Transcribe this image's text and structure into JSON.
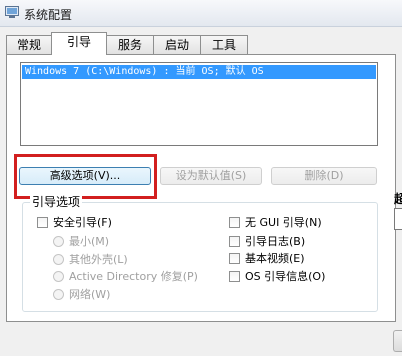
{
  "window": {
    "title": "系统配置"
  },
  "tabs": [
    {
      "label": "常规"
    },
    {
      "label": "引导"
    },
    {
      "label": "服务"
    },
    {
      "label": "启动"
    },
    {
      "label": "工具"
    }
  ],
  "boot_list": {
    "items": [
      {
        "text": "Windows 7 (C:\\Windows) : 当前 OS; 默认 OS"
      }
    ]
  },
  "buttons": {
    "advanced": "高级选项(V)...",
    "set_default": "设为默认值(S)",
    "delete": "删除(D)"
  },
  "boot_options": {
    "group_label": "引导选项",
    "safe_boot": "安全引导(F)",
    "minimal": "最小(M)",
    "alternate_shell": "其他外壳(L)",
    "active_directory_repair": "Active Directory 修复(P)",
    "network": "网络(W)",
    "no_gui_boot": "无 GUI 引导(N)",
    "boot_log": "引导日志(B)",
    "base_video": "基本视频(E)",
    "os_boot_info": "OS 引导信息(O)"
  },
  "timeout": {
    "label_partial": "超"
  },
  "colors": {
    "selection": "#3399ff",
    "highlight_frame": "#d21f1f"
  }
}
